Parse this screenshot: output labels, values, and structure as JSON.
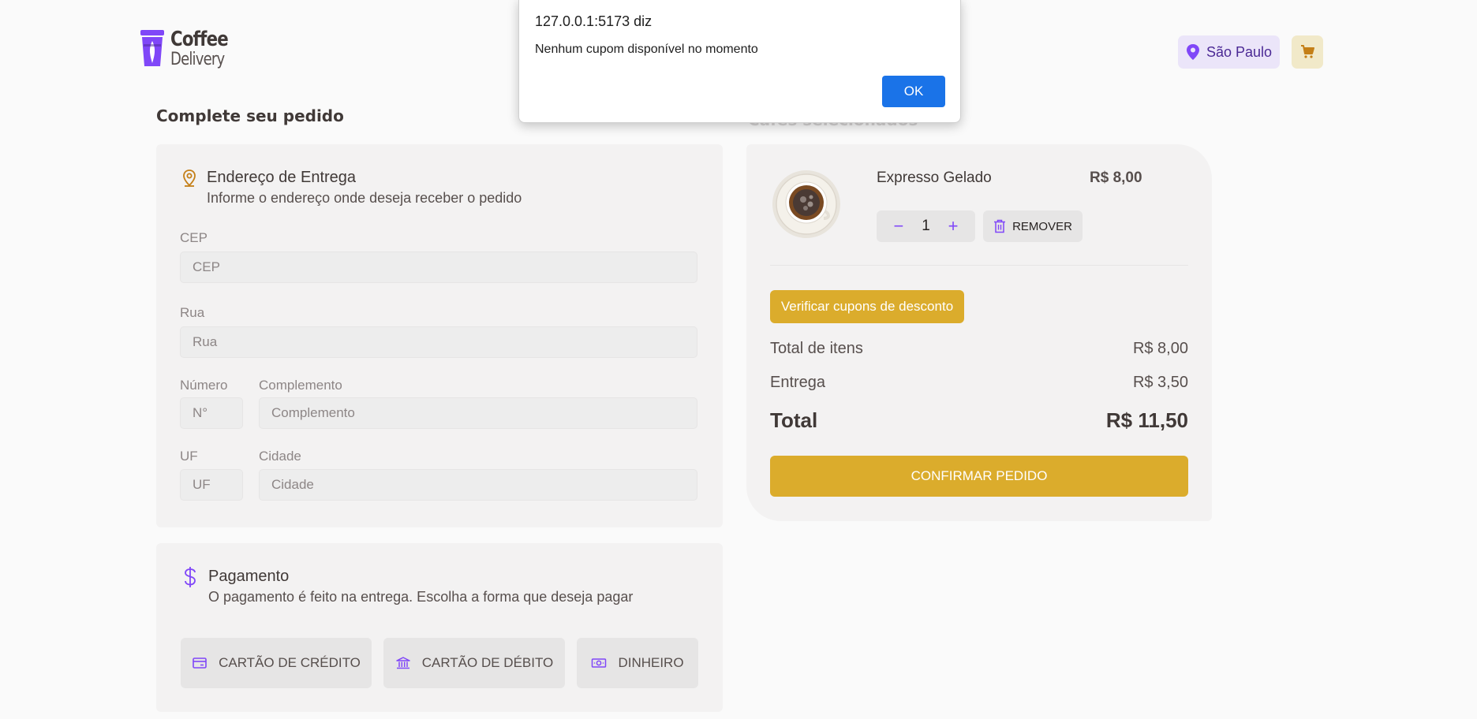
{
  "header": {
    "logo_line1": "Coffee",
    "logo_line2": "Delivery",
    "location": "São Paulo",
    "colors": {
      "purple": "#8047f8",
      "yellow": "#dbac2c",
      "location_bg": "#ebe5f9",
      "cart_bg": "#f1e9c9"
    }
  },
  "checkout": {
    "title": "Complete seu pedido",
    "cart_title": "Cafés selecionados"
  },
  "address": {
    "title": "Endereço de Entrega",
    "subtitle": "Informe o endereço onde deseja receber o pedido",
    "fields": {
      "cep": {
        "label": "CEP",
        "placeholder": "CEP"
      },
      "rua": {
        "label": "Rua",
        "placeholder": "Rua"
      },
      "numero": {
        "label": "Número",
        "placeholder": "N°"
      },
      "complemento": {
        "label": "Complemento",
        "placeholder": "Complemento"
      },
      "uf": {
        "label": "UF",
        "placeholder": "UF"
      },
      "cidade": {
        "label": "Cidade",
        "placeholder": "Cidade"
      }
    }
  },
  "payment": {
    "title": "Pagamento",
    "subtitle": "O pagamento é feito na entrega. Escolha a forma que deseja pagar",
    "options": [
      "CARTÃO DE CRÉDITO",
      "CARTÃO DE DÉBITO",
      "DINHEIRO"
    ]
  },
  "cart": {
    "item": {
      "name": "Expresso Gelado",
      "price": "R$ 8,00",
      "quantity": "1",
      "remove_label": "REMOVER"
    },
    "coupon_button": "Verificar cupons de desconto",
    "summary": {
      "items_label": "Total de itens",
      "items_value": "R$ 8,00",
      "delivery_label": "Entrega",
      "delivery_value": "R$ 3,50",
      "total_label": "Total",
      "total_value": "R$ 11,50"
    },
    "confirm_button": "CONFIRMAR PEDIDO"
  },
  "alert": {
    "title": "127.0.0.1:5173 diz",
    "message": "Nenhum cupom disponível no momento",
    "ok_label": "OK"
  }
}
